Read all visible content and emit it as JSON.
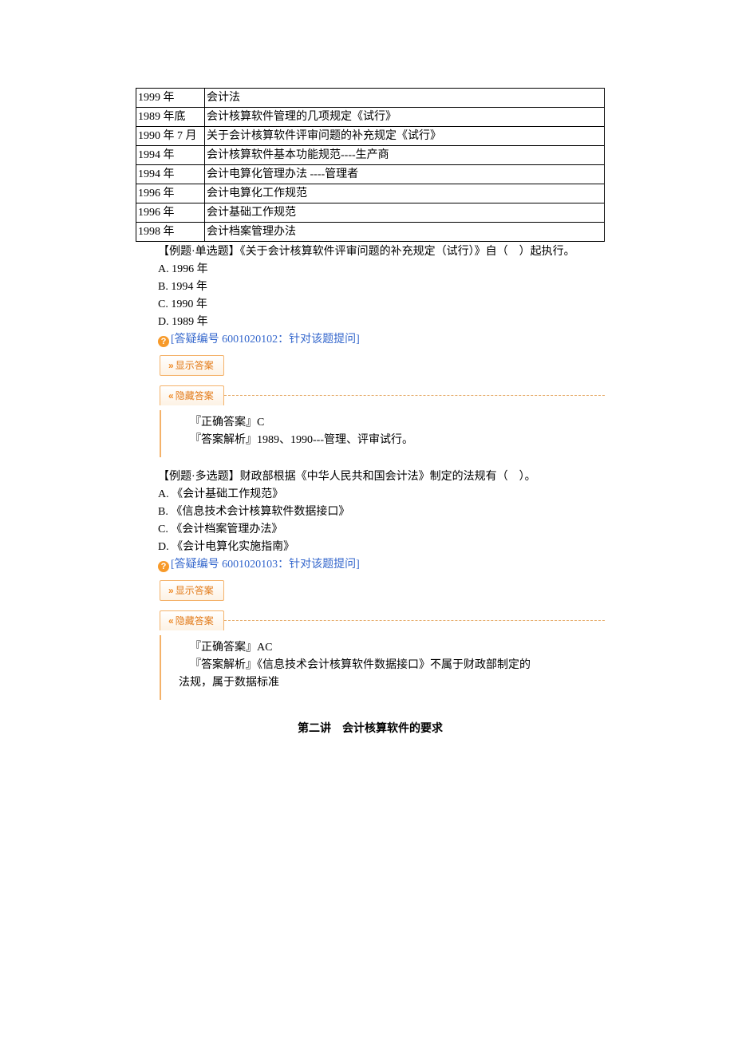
{
  "table": {
    "rows": [
      {
        "year": "1999 年",
        "desc": "会计法"
      },
      {
        "year": "1989 年底",
        "desc": "会计核算软件管理的几项规定《试行》"
      },
      {
        "year": "1990 年 7 月",
        "desc": "关于会计核算软件评审问题的补充规定《试行》"
      },
      {
        "year": "1994 年",
        "desc": "会计核算软件基本功能规范----生产商"
      },
      {
        "year": "1994 年",
        "desc": "会计电算化管理办法 ----管理者"
      },
      {
        "year": "1996 年",
        "desc": "会计电算化工作规范"
      },
      {
        "year": "1996 年",
        "desc": "会计基础工作规范"
      },
      {
        "year": "1998 年",
        "desc": "会计档案管理办法"
      }
    ]
  },
  "q1": {
    "stem": "【例题·单选题】《关于会计核算软件评审问题的补充规定（试行）》自（　）起执行。",
    "options": {
      "a": "A. 1996 年",
      "b": "B. 1994 年",
      "c": "C. 1990 年",
      "d": "D. 1989 年"
    },
    "feedback_icon": "?",
    "feedback": "[答疑编号 6001020102：针对该题提问]",
    "show_label": "显示答案",
    "show_chev": "»",
    "hide_label": "隐藏答案",
    "hide_chev": "«",
    "answer_label": "『正确答案』C",
    "analysis": "『答案解析』1989、1990---管理、评审试行。"
  },
  "q2": {
    "stem": "【例题·多选题】财政部根据《中华人民共和国会计法》制定的法规有（　）。",
    "options": {
      "a": "A. 《会计基础工作规范》",
      "b": "B. 《信息技术会计核算软件数据接口》",
      "c": "C. 《会计档案管理办法》",
      "d": "D. 《会计电算化实施指南》"
    },
    "feedback_icon": "?",
    "feedback": "[答疑编号 6001020103：针对该题提问]",
    "show_label": "显示答案",
    "show_chev": "»",
    "hide_label": "隐藏答案",
    "hide_chev": "«",
    "answer_label": "『正确答案』AC",
    "analysis_line1": "『答案解析』《信息技术会计核算软件数据接口》不属于财政部制定的",
    "analysis_line2": "法规，属于数据标准"
  },
  "section2_title": "第二讲　会计核算软件的要求"
}
